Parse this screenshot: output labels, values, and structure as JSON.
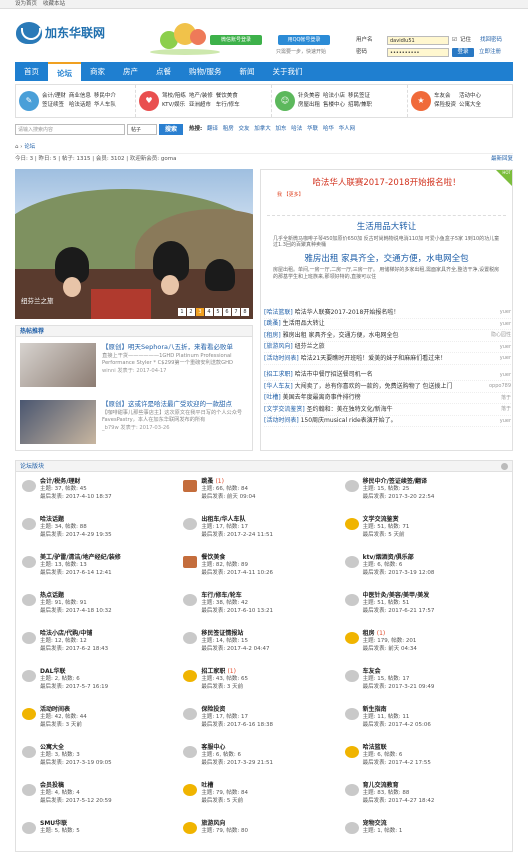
{
  "topbar": {
    "home": "设为首页",
    "fav": "收藏本站"
  },
  "brand": {
    "name": "加东华联网"
  },
  "social": {
    "wechat": "微信账号登录",
    "qq": "用QQ帐号登录",
    "hint": "只需要一步，快速开始"
  },
  "login": {
    "user_label": "用户名",
    "user_value": "davidlu51",
    "pass_label": "密码",
    "pass_value": "••••••••••",
    "remember": "记住",
    "forgot": "找回密码",
    "submit": "登录",
    "register": "立即注册"
  },
  "nav": [
    "首页",
    "论坛",
    "商家",
    "房产",
    "点餐",
    "购物/服务",
    "新闻",
    "关于我们"
  ],
  "quick": [
    {
      "icon": "✎",
      "color": "#4a9fd8",
      "links": [
        "会计/理财",
        "商业信息",
        "移民中介",
        "签证续签",
        "哈法话题",
        "华人车队"
      ]
    },
    {
      "icon": "♥",
      "color": "#e94f4f",
      "links": [
        "驾校/陪练",
        "地产/装修",
        "餐饮美食",
        "KTV/娱乐",
        "亚洲超市",
        "车行/修车"
      ]
    },
    {
      "icon": "☺",
      "color": "#5cb85c",
      "links": [
        "针灸美容",
        "哈法小店",
        "移民签证",
        "房屋出租",
        "售楼中心",
        "招聘/兼职"
      ]
    },
    {
      "icon": "★",
      "color": "#f06a3a",
      "links": [
        "车友会",
        "活动中心",
        "保险投资",
        "公寓大全"
      ]
    }
  ],
  "search": {
    "placeholder": "请输入搜索内容",
    "scope": "帖子",
    "button": "搜索",
    "hot_label": "热搜:",
    "hot": [
      "翻译",
      "租房",
      "交友",
      "加拿大",
      "加东",
      "哈法",
      "华联",
      "哈华",
      "华人网"
    ]
  },
  "crumb": {
    "home": "论坛"
  },
  "stats": {
    "text": "今日: 3 | 昨日: 5 | 帖子: 1315 | 会员: 3102 | 欢迎新会员: goma",
    "latest": "最新回复"
  },
  "slideshow": {
    "caption": "纽芬兰之旅",
    "pages": [
      "1",
      "2",
      "3",
      "4",
      "5",
      "6",
      "7",
      "8"
    ],
    "active": 2
  },
  "hot_panel": {
    "title": "热帖推荐",
    "items": [
      {
        "title": "【原创】明天Sephora八五折，来看看必败单",
        "text": "直接上干货——————1GHD Platinum Professional Performance Styler * C$299第一个重磅安利送款GHD",
        "author": "winni",
        "date": "发表于: 2017-04-17"
      },
      {
        "title": "【原创】这或许是哈法最广受欢迎的一款甜点",
        "text": "【咖啡甜事儿那些事店主】这次原文在我平日写的个人公众号FavesPastry，本人在加东华联网发布的所有",
        "author": "_b79w",
        "date": "发表于: 2017-03-26"
      }
    ]
  },
  "news": {
    "headline": "哈法华人联赛2017-2018开始报名啦！",
    "headline_more": "我 【更多】",
    "story2_title": "生活用品大转让",
    "story2_text": "几乎全新微马咖啡子琴450加原价650加 反古时尚韩物说电消110加 可爱小鱼盒子5家 1到10的功儿童过1.3回的百聚真种卖桶",
    "story3_title": "雅房出租 家具齐全，交通方便，水电网全包",
    "story3_text": "房屋出租。单间,一房一厅,二房一厅,三房一厅。 用储梯好的多家出租,需面家具齐全,整洁干净,设置税房的那基学生和上班族来,那领好特的,直接可以住",
    "list": [
      {
        "cat": "[哈法篮联]",
        "title": "哈法华人联赛2017-2018开始报名啦！",
        "user": "yuer"
      },
      {
        "cat": "[跳蚤]",
        "title": "生活用品大转让",
        "user": "yuer"
      },
      {
        "cat": "[租房]",
        "title": "雅房出租 家具齐全，交通方便，水电网全包",
        "user": "隐心园性"
      },
      {
        "cat": "[旅游风向]",
        "title": "纽芬兰之旅",
        "user": "yuer"
      },
      {
        "cat": "[活动时间表]",
        "title": "哈法21天要瞧时开班啦！爱美的妹子和麻麻们看过来！",
        "user": "yuer"
      },
      {
        "cat": "[招工求职]",
        "title": "哈法市中餐厅招送餐司机一名",
        "user": "yuer"
      },
      {
        "cat": "[华人车友]",
        "title": "大闯卖了，总有你喜欢的一款的，免费送购物了 包送拨上门",
        "user": "oppo789"
      },
      {
        "cat": "[吐槽]",
        "title": "美国去年度最离奇事件排行榜",
        "user": "落于"
      },
      {
        "cat": "[文学交流鉴赏]",
        "title": "圣约翰和：美在独特文化/新海牛",
        "user": "落于"
      },
      {
        "cat": "[活动时间表]",
        "title": "150周庆musical ride表演开始了。",
        "user": "yuer"
      }
    ]
  },
  "forum": {
    "title": "论坛版块",
    "boards": [
      {
        "name": "会计/税务/理财",
        "count": "",
        "topics": "主题: 37, 帖数: 45",
        "last": "最后发表: 2017-4-10 18:37",
        "type": "normal"
      },
      {
        "name": "跳蚤",
        "count": "(1)",
        "topics": "主题: 66, 帖数: 84",
        "last": "最后发表: 前天 09:04",
        "type": "img"
      },
      {
        "name": "移民中介/签证续签/翻译",
        "count": "",
        "topics": "主题: 15, 帖数: 25",
        "last": "最后发表: 2017-3-20 22:54",
        "type": "normal"
      },
      {
        "name": "哈法话题",
        "count": "",
        "topics": "主题: 34, 帖数: 88",
        "last": "最后发表: 2017-4-29 19:35",
        "type": "normal"
      },
      {
        "name": "出租车/华人车队",
        "count": "",
        "topics": "主题: 17, 帖数: 17",
        "last": "最后发表: 2017-2-24 11:51",
        "type": "normal"
      },
      {
        "name": "文学交流鉴赏",
        "count": "",
        "topics": "主题: 51, 帖数: 71",
        "last": "最后发表: 5 天前",
        "type": "new"
      },
      {
        "name": "美工/驴雷/清洁/地产经纪/装修",
        "count": "",
        "topics": "主题: 13, 帖数: 13",
        "last": "最后发表: 2017-6-14 12:41",
        "type": "normal"
      },
      {
        "name": "餐饮美食",
        "count": "",
        "topics": "主题: 82, 帖数: 89",
        "last": "最后发表: 2017-4-11 10:26",
        "type": "img"
      },
      {
        "name": "ktv/烟酒资/俱乐部",
        "count": "",
        "topics": "主题: 6, 帖数: 6",
        "last": "最后发表: 2017-3-19 12:08",
        "type": "normal"
      },
      {
        "name": "热点话题",
        "count": "",
        "topics": "主题: 91, 帖数: 91",
        "last": "最后发表: 2017-4-18 10:32",
        "type": "normal"
      },
      {
        "name": "车行/修车/轮车",
        "count": "",
        "topics": "主题: 38, 帖数: 42",
        "last": "最后发表: 2017-6-10 13:21",
        "type": "normal"
      },
      {
        "name": "中医针灸/美容/美甲/美发",
        "count": "",
        "topics": "主题: 51, 帖数: 51",
        "last": "最后发表: 2017-6-21 17:57",
        "type": "normal"
      },
      {
        "name": "哈法小店/代购/中铺",
        "count": "",
        "topics": "主题: 12, 帖数: 12",
        "last": "最后发表: 2017-6-2 18:43",
        "type": "normal"
      },
      {
        "name": "移民签证情报站",
        "count": "",
        "topics": "主题: 14, 帖数: 15",
        "last": "最后发表: 2017-4-2 04:47",
        "type": "normal"
      },
      {
        "name": "租房",
        "count": "(1)",
        "topics": "主题: 179, 帖数: 201",
        "last": "最后发表: 前天 04:34",
        "type": "new"
      },
      {
        "name": "DAL华联",
        "count": "",
        "topics": "主题: 2, 帖数: 6",
        "last": "最后发表: 2017-5-7 16:19",
        "type": "normal"
      },
      {
        "name": "招工家职",
        "count": "(1)",
        "topics": "主题: 43, 帖数: 65",
        "last": "最后发表: 3 天前",
        "type": "new"
      },
      {
        "name": "车友会",
        "count": "",
        "topics": "主题: 15, 帖数: 17",
        "last": "最后发表: 2017-3-21 09:49",
        "type": "normal"
      },
      {
        "name": "活动时间表",
        "count": "",
        "topics": "主题: 42, 帖数: 44",
        "last": "最后发表: 3 天前",
        "type": "new"
      },
      {
        "name": "保险投资",
        "count": "",
        "topics": "主题: 17, 帖数: 17",
        "last": "最后发表: 2017-6-16 18:38",
        "type": "normal"
      },
      {
        "name": "新生指南",
        "count": "",
        "topics": "主题: 11, 帖数: 11",
        "last": "最后发表: 2017-4-2 05:06",
        "type": "normal"
      },
      {
        "name": "公寓大全",
        "count": "",
        "topics": "主题: 3, 帖数: 3",
        "last": "最后发表: 2017-3-19 09:05",
        "type": "normal"
      },
      {
        "name": "客服中心",
        "count": "",
        "topics": "主题: 6, 帖数: 6",
        "last": "最后发表: 2017-3-29 21:51",
        "type": "normal"
      },
      {
        "name": "哈法篮联",
        "count": "",
        "topics": "主题: 6, 帖数: 6",
        "last": "最后发表: 2017-4-2 17:55",
        "type": "new"
      },
      {
        "name": "会员投稿",
        "count": "",
        "topics": "主题: 4, 帖数: 4",
        "last": "最后发表: 2017-5-12 20:59",
        "type": "normal"
      },
      {
        "name": "吐槽",
        "count": "",
        "topics": "主题: 79, 帖数: 84",
        "last": "最后发表: 5 天前",
        "type": "new"
      },
      {
        "name": "育儿交流教育",
        "count": "",
        "topics": "主题: 83, 帖数: 88",
        "last": "最后发表: 2017-4-27 18:42",
        "type": "normal"
      },
      {
        "name": "SMU华联",
        "count": "",
        "topics": "主题: 5, 帖数: 5",
        "last": "",
        "type": "normal"
      },
      {
        "name": "旅游风向",
        "count": "",
        "topics": "主题: 79, 帖数: 80",
        "last": "",
        "type": "new"
      },
      {
        "name": "宠物交流",
        "count": "",
        "topics": "主题: 1, 帖数: 1",
        "last": "",
        "type": "normal"
      }
    ]
  }
}
